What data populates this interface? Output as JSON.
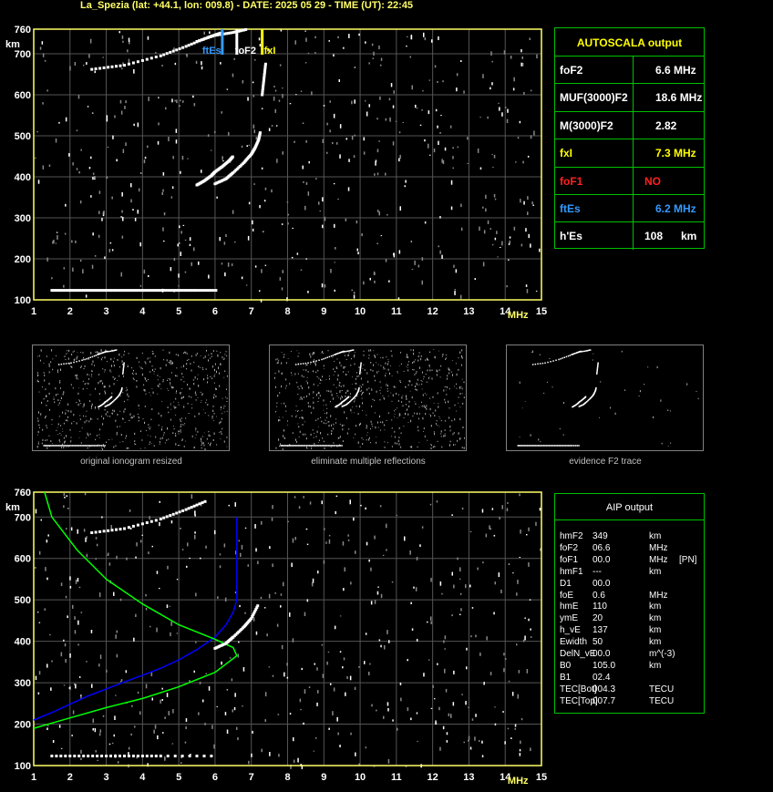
{
  "title": "La_Spezia (lat: +44.1, lon: 009.8) - DATE: 2025 05 29 - TIME (UT): 22:45",
  "axis": {
    "x_ticks": [
      "1",
      "2",
      "3",
      "4",
      "5",
      "6",
      "7",
      "8",
      "9",
      "10",
      "11",
      "12",
      "13",
      "14",
      "15"
    ],
    "x_unit": "MHz",
    "y_ticks": [
      "100",
      "200",
      "300",
      "400",
      "500",
      "600",
      "700",
      "760"
    ],
    "y_unit": "km"
  },
  "markers": [
    {
      "label": "ftEs",
      "x": 6.2,
      "color": "#3399ff"
    },
    {
      "label": "foF2",
      "x": 6.6,
      "color": "#ffffff"
    },
    {
      "label": "fxI",
      "x": 7.3,
      "color": "#ffff00"
    }
  ],
  "autoscala": {
    "title": "AUTOSCALA output",
    "rows": [
      {
        "param": "foF2",
        "value": "6.6",
        "unit": "MHz",
        "color": "#ffffff"
      },
      {
        "param": "MUF(3000)F2",
        "value": "18.6",
        "unit": "MHz",
        "color": "#ffffff"
      },
      {
        "param": "M(3000)F2",
        "value": "2.82",
        "unit": "",
        "color": "#ffffff"
      },
      {
        "param": "fxI",
        "value": "7.3",
        "unit": "MHz",
        "color": "#ffff00"
      },
      {
        "param": "foF1",
        "value": "NO",
        "unit": "",
        "color": "#ff2020"
      },
      {
        "param": "ftEs",
        "value": "6.2",
        "unit": "MHz",
        "color": "#3399ff"
      },
      {
        "param": "h'Es",
        "value": "108",
        "unit": "km",
        "color": "#ffffff"
      }
    ]
  },
  "thumbnails": {
    "captions": [
      "original ionogram resized",
      "eliminate multiple reflections",
      "evidence F2 trace"
    ]
  },
  "aip": {
    "title": "AIP output",
    "rows": [
      {
        "param": "hmF2",
        "value": "349",
        "unit": "km",
        "note": ""
      },
      {
        "param": "foF2",
        "value": "06.6",
        "unit": "MHz",
        "note": ""
      },
      {
        "param": "foF1",
        "value": "00.0",
        "unit": "MHz",
        "note": "[PN]"
      },
      {
        "param": "hmF1",
        "value": "---",
        "unit": "km",
        "note": ""
      },
      {
        "param": "D1",
        "value": "00.0",
        "unit": "",
        "note": ""
      },
      {
        "param": "foE",
        "value": "0.6",
        "unit": "MHz",
        "note": ""
      },
      {
        "param": "hmE",
        "value": "110",
        "unit": "km",
        "note": ""
      },
      {
        "param": "ymE",
        "value": "20",
        "unit": "km",
        "note": ""
      },
      {
        "param": "h_vE",
        "value": "137",
        "unit": "km",
        "note": ""
      },
      {
        "param": "Ewidth",
        "value": "50",
        "unit": "km",
        "note": ""
      },
      {
        "param": "DelN_vE",
        "value": "00.0",
        "unit": "m^(-3)",
        "note": ""
      },
      {
        "param": "B0",
        "value": "105.0",
        "unit": "km",
        "note": ""
      },
      {
        "param": "B1",
        "value": "02.4",
        "unit": "",
        "note": ""
      },
      {
        "param": "TEC[Bot]",
        "value": "004.3",
        "unit": "TECU",
        "note": ""
      },
      {
        "param": "TEC[Top]",
        "value": "007.7",
        "unit": "TECU",
        "note": ""
      }
    ]
  },
  "chart_data": [
    {
      "type": "scatter",
      "xlim": [
        1,
        15
      ],
      "ylim": [
        100,
        760
      ],
      "grid": true,
      "series": [
        {
          "points": [
            [
              1.5,
              123
            ],
            [
              2,
              123
            ],
            [
              2.5,
              123
            ],
            [
              3,
              123
            ],
            [
              3.5,
              123
            ],
            [
              4,
              123
            ],
            [
              4.5,
              123
            ],
            [
              5,
              123
            ],
            [
              5.5,
              123
            ],
            [
              6.1,
              123
            ]
          ]
        },
        {
          "points": [
            [
              5.5,
              380
            ],
            [
              5.7,
              390
            ],
            [
              5.9,
              403
            ],
            [
              6.0,
              412
            ],
            [
              6.2,
              425
            ],
            [
              6.4,
              440
            ],
            [
              6.5,
              450
            ]
          ]
        },
        {
          "points": [
            [
              6.0,
              383
            ],
            [
              6.3,
              395
            ],
            [
              6.5,
              410
            ],
            [
              6.8,
              435
            ],
            [
              7.0,
              455
            ],
            [
              7.1,
              470
            ],
            [
              7.2,
              490
            ],
            [
              7.25,
              510
            ]
          ]
        },
        {
          "points": [
            [
              2.6,
              662
            ],
            [
              3.5,
              672
            ],
            [
              4.5,
              695
            ],
            [
              5.2,
              718
            ],
            [
              5.8,
              740
            ],
            [
              6.2,
              752
            ]
          ]
        },
        {
          "points": [
            [
              5.5,
              730
            ],
            [
              6.0,
              745
            ],
            [
              6.5,
              752
            ],
            [
              6.9,
              760
            ]
          ]
        },
        {
          "points": [
            [
              7.3,
              600
            ],
            [
              7.35,
              640
            ],
            [
              7.4,
              680
            ]
          ]
        }
      ]
    },
    {
      "type": "line",
      "xlim": [
        1,
        15
      ],
      "ylim": [
        100,
        760
      ],
      "grid": true,
      "series": [
        {
          "color": "#0000ff",
          "points": [
            [
              1,
              210
            ],
            [
              1.5,
              228
            ],
            [
              2,
              248
            ],
            [
              2.5,
              268
            ],
            [
              3,
              285
            ],
            [
              3.5,
              302
            ],
            [
              4,
              318
            ],
            [
              4.5,
              335
            ],
            [
              5,
              355
            ],
            [
              5.5,
              380
            ],
            [
              6.0,
              410
            ],
            [
              6.3,
              440
            ],
            [
              6.5,
              470
            ],
            [
              6.6,
              500
            ],
            [
              6.6,
              600
            ],
            [
              6.6,
              700
            ]
          ]
        },
        {
          "color": "#00ff00",
          "points": [
            [
              1,
              190
            ],
            [
              2,
              215
            ],
            [
              3,
              240
            ],
            [
              4,
              262
            ],
            [
              5,
              290
            ],
            [
              6,
              325
            ],
            [
              6.6,
              365
            ],
            [
              6.5,
              385
            ],
            [
              6,
              405
            ],
            [
              5,
              440
            ],
            [
              4,
              490
            ],
            [
              3,
              550
            ],
            [
              2.2,
              620
            ],
            [
              1.5,
              700
            ],
            [
              1.3,
              760
            ]
          ]
        },
        {
          "points": [
            [
              6.0,
              383
            ],
            [
              6.3,
              395
            ],
            [
              6.5,
              410
            ],
            [
              6.8,
              435
            ],
            [
              7.0,
              455
            ],
            [
              7.2,
              490
            ]
          ]
        },
        {
          "points": [
            [
              2.6,
              662
            ],
            [
              3.5,
              672
            ],
            [
              4.5,
              695
            ],
            [
              5.2,
              718
            ],
            [
              5.8,
              740
            ]
          ]
        },
        {
          "points": [
            [
              1.5,
              123
            ],
            [
              2.5,
              123
            ],
            [
              3.5,
              123
            ],
            [
              4.5,
              123
            ],
            [
              6.1,
              123
            ]
          ]
        }
      ]
    }
  ]
}
